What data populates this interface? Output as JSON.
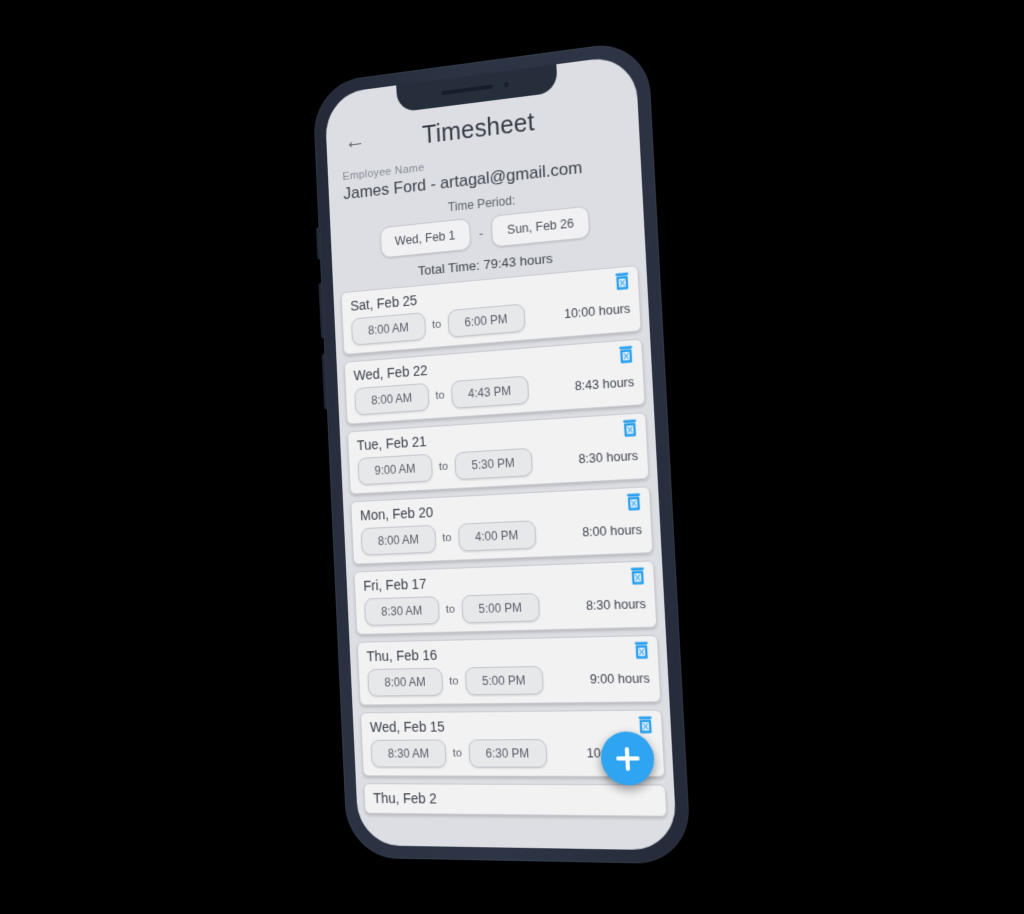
{
  "app": {
    "title": "Timesheet",
    "back_icon": "arrow-left-icon",
    "accent_color": "#2fa4f0",
    "screen_bg": "#dcdee3",
    "frame_color": "#2b3242"
  },
  "employee": {
    "label": "Employee Name",
    "value": "James Ford - artagal@gmail.com"
  },
  "period": {
    "label": "Time Period:",
    "start": "Wed, Feb 1",
    "dash": "-",
    "end": "Sun, Feb 26"
  },
  "total": {
    "label": "Total Time:",
    "value": "79:43 hours"
  },
  "list": {
    "to_label": "to",
    "delete_icon": "trash-icon",
    "entries": [
      {
        "date": "Sat, Feb 25",
        "start": "8:00 AM",
        "end": "6:00 PM",
        "hours": "10:00 hours"
      },
      {
        "date": "Wed, Feb 22",
        "start": "8:00 AM",
        "end": "4:43 PM",
        "hours": "8:43 hours"
      },
      {
        "date": "Tue, Feb 21",
        "start": "9:00 AM",
        "end": "5:30 PM",
        "hours": "8:30 hours"
      },
      {
        "date": "Mon, Feb 20",
        "start": "8:00 AM",
        "end": "4:00 PM",
        "hours": "8:00 hours"
      },
      {
        "date": "Fri, Feb 17",
        "start": "8:30 AM",
        "end": "5:00 PM",
        "hours": "8:30 hours"
      },
      {
        "date": "Thu, Feb 16",
        "start": "8:00 AM",
        "end": "5:00 PM",
        "hours": "9:00 hours"
      },
      {
        "date": "Wed, Feb 15",
        "start": "8:30 AM",
        "end": "6:30 PM",
        "hours": "10:00 hours"
      },
      {
        "date": "Thu, Feb 2",
        "start": "",
        "end": "",
        "hours": ""
      }
    ]
  },
  "fab": {
    "icon": "plus-icon",
    "label": "+"
  }
}
